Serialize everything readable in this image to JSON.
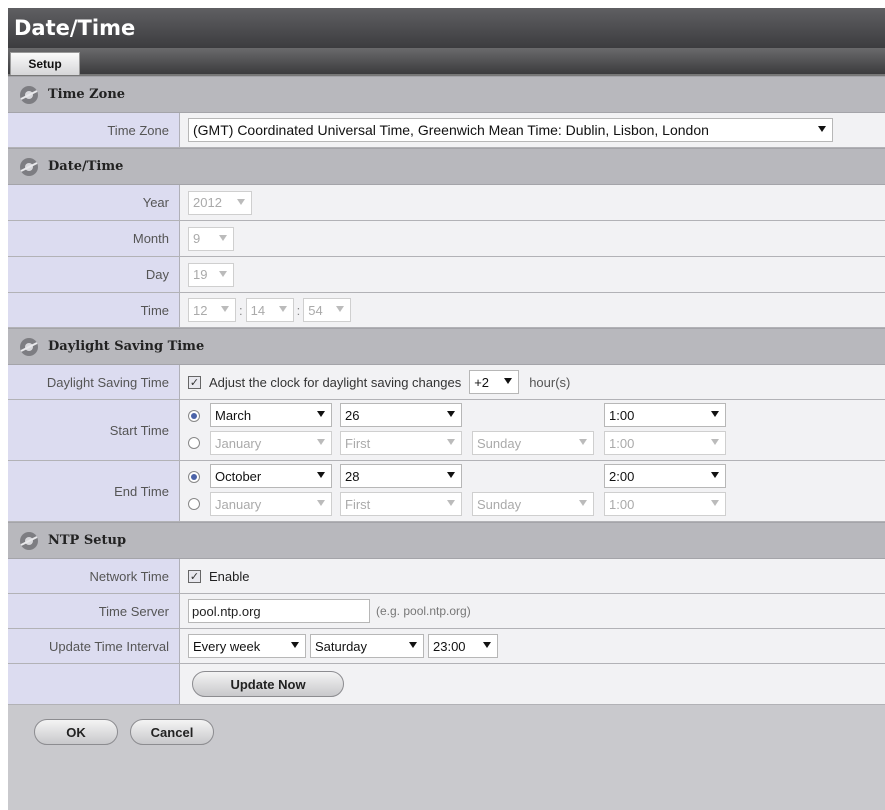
{
  "window": {
    "title": "Date/Time"
  },
  "tabs": [
    "Setup"
  ],
  "sections": {
    "timezone": "Time Zone",
    "datetime": "Date/Time",
    "dst": "Daylight Saving Time",
    "ntp": "NTP Setup"
  },
  "timezone": {
    "label": "Time Zone",
    "value": "(GMT) Coordinated Universal Time, Greenwich Mean Time: Dublin, Lisbon, London"
  },
  "datetime": {
    "year_label": "Year",
    "year": "2012",
    "month_label": "Month",
    "month": "9",
    "day_label": "Day",
    "day": "19",
    "time_label": "Time",
    "hour": "12",
    "minute": "14",
    "second": "54"
  },
  "dst": {
    "label": "Daylight Saving Time",
    "adjust_text": "Adjust the clock for daylight saving changes",
    "offset": "+2",
    "unit": "hour(s)",
    "start_label": "Start Time",
    "start_a": {
      "month": "March",
      "day": "26",
      "time": "1:00"
    },
    "start_b": {
      "month": "January",
      "week": "First",
      "weekday": "Sunday",
      "time": "1:00"
    },
    "end_label": "End Time",
    "end_a": {
      "month": "October",
      "day": "28",
      "time": "2:00"
    },
    "end_b": {
      "month": "January",
      "week": "First",
      "weekday": "Sunday",
      "time": "1:00"
    }
  },
  "ntp": {
    "network_label": "Network Time",
    "enable": "Enable",
    "server_label": "Time Server",
    "server_value": "pool.ntp.org",
    "server_hint": "(e.g. pool.ntp.org)",
    "interval_label": "Update Time Interval",
    "interval": "Every week",
    "weekday": "Saturday",
    "time": "23:00",
    "update_button": "Update Now"
  },
  "footer": {
    "ok": "OK",
    "cancel": "Cancel"
  },
  "icons": [
    "gear-icon",
    "checkbox-icon",
    "radio-icon",
    "dropdown-arrow-icon"
  ],
  "colors": {
    "accent": "#4b63a8",
    "label_bg": "#dcdcf0",
    "section_bg": "#b8b8bd",
    "titlebar": "#4a4a4d"
  }
}
